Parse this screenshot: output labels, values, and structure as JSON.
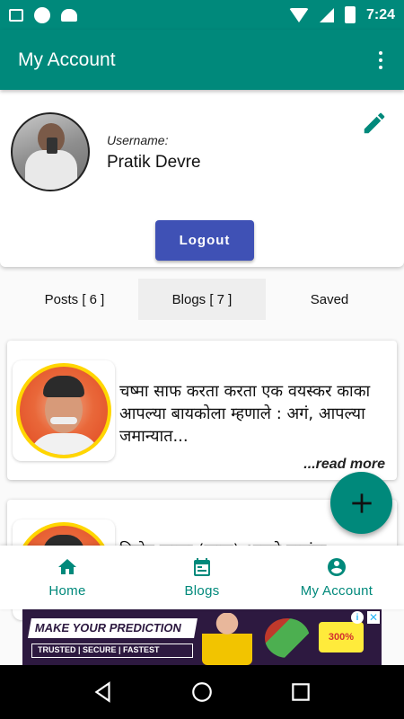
{
  "status_bar": {
    "time": "7:24",
    "icons": [
      "image-icon",
      "circle-icon",
      "android-icon",
      "wifi-icon",
      "signal-icon",
      "battery-icon"
    ]
  },
  "app_bar": {
    "title": "My Account",
    "menu_icon": "more-vert-icon"
  },
  "profile": {
    "username_label": "Username:",
    "username": "Pratik Devre",
    "edit_icon": "pencil-icon",
    "logout_label": "Logout"
  },
  "tabs": [
    {
      "label": "Posts [ 6 ]",
      "active": false
    },
    {
      "label": "Blogs [ 7 ]",
      "active": true
    },
    {
      "label": "Saved",
      "active": false
    }
  ],
  "blogs": [
    {
      "excerpt": "चष्मा साफ करता करता एक वयस्कर काका आपल्या बायकोला म्हणाले : अगं, आपल्या जमान्यात...",
      "read_more": "...read more"
    },
    {
      "excerpt": "विनोद काका (काकू) आपले बाबांना :",
      "read_more": ""
    }
  ],
  "fab": {
    "icon": "plus-icon"
  },
  "bottom_nav": [
    {
      "label": "Home",
      "icon": "home-icon"
    },
    {
      "label": "Blogs",
      "icon": "calendar-icon"
    },
    {
      "label": "My Account",
      "icon": "account-circle-icon"
    }
  ],
  "ad": {
    "title": "MAKE YOUR PREDICTION",
    "subtitle": "TRUSTED | SECURE | FASTEST",
    "badge": "300%",
    "info": "i",
    "close": "✕"
  },
  "colors": {
    "primary": "#00897b",
    "accent_button": "#3f51b5",
    "tab_active_bg": "#eeeeee",
    "thumb_border": "#ffd600"
  }
}
